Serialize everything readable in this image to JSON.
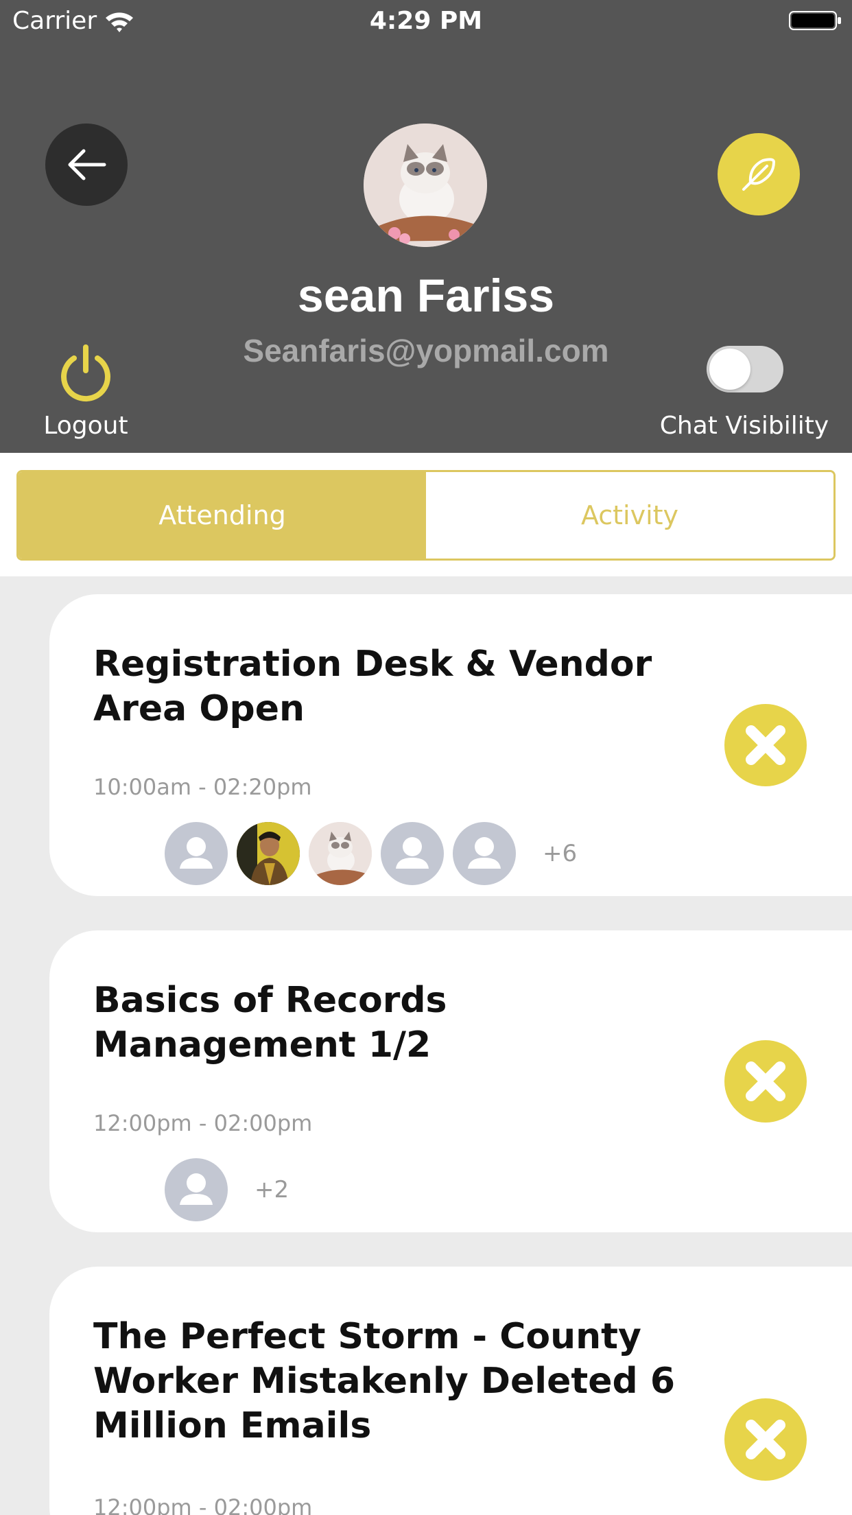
{
  "status_bar": {
    "carrier": "Carrier",
    "time": "4:29 PM"
  },
  "profile": {
    "name": "sean Fariss",
    "email": "Seanfaris@yopmail.com",
    "logout_label": "Logout",
    "chat_visibility_label": "Chat Visibility",
    "chat_visibility_on": false
  },
  "tabs": [
    {
      "label": "Attending",
      "active": true
    },
    {
      "label": "Activity",
      "active": false
    }
  ],
  "events": [
    {
      "title": "Registration Desk & Vendor Area Open",
      "time": "10:00am - 02:20pm",
      "attendees": [
        "default-avatar",
        "photo-avatar-man",
        "photo-avatar-cat",
        "default-avatar",
        "default-avatar"
      ],
      "more": "+6"
    },
    {
      "title": "Basics of Records Management 1/2",
      "time": "12:00pm - 02:00pm",
      "attendees": [
        "default-avatar"
      ],
      "more": "+2"
    },
    {
      "title": "The Perfect Storm - County Worker Mistakenly Deleted 6 Million Emails",
      "time": "12:00pm - 02:00pm",
      "attendees": [],
      "more": ""
    }
  ],
  "colors": {
    "header_bg": "#555555",
    "accent": "#dcc760",
    "button_yellow": "#e7d44a",
    "page_bg": "#ebebeb"
  }
}
